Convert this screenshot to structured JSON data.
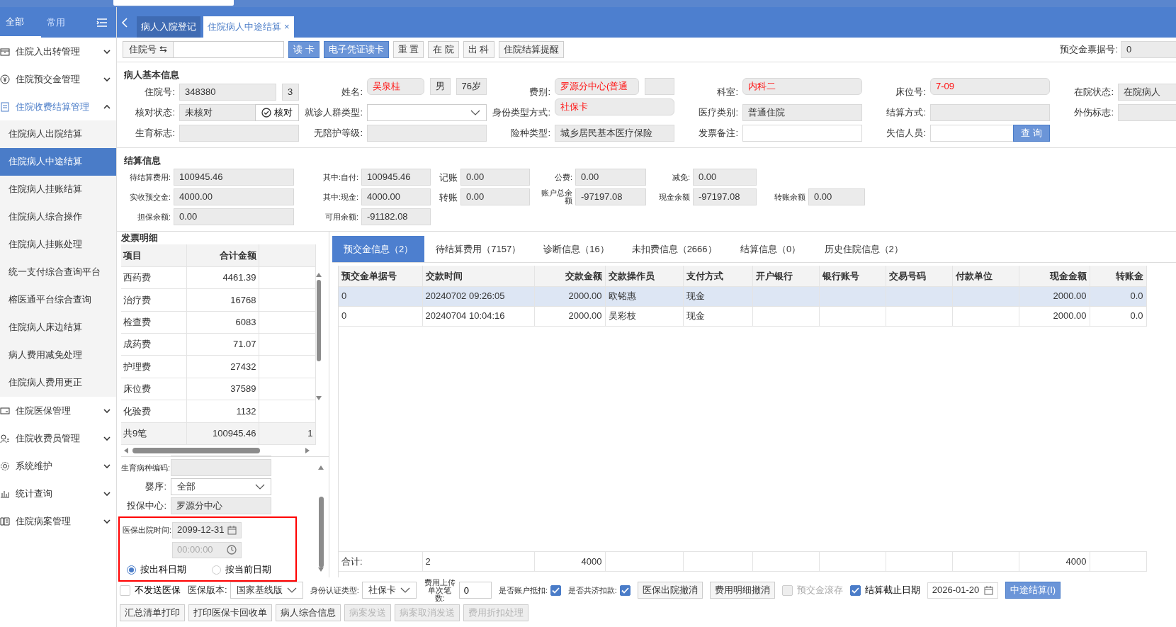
{
  "sidebar": {
    "tabs": [
      {
        "label": "全部",
        "selected": true
      },
      {
        "label": "常用",
        "selected": false
      }
    ],
    "items": [
      {
        "label": "住院入出转管理",
        "expanded": false
      },
      {
        "label": "住院预交金管理",
        "expanded": false
      },
      {
        "label": "住院收费结算管理",
        "expanded": true,
        "children": [
          {
            "label": "住院病人出院结算",
            "selected": false
          },
          {
            "label": "住院病人中途结算",
            "selected": true
          },
          {
            "label": "住院病人挂账结算",
            "selected": false
          },
          {
            "label": "住院病人综合操作",
            "selected": false
          },
          {
            "label": "住院病人挂账处理",
            "selected": false
          },
          {
            "label": "统一支付综合查询平台",
            "selected": false
          },
          {
            "label": "榕医通平台综合查询",
            "selected": false
          },
          {
            "label": "住院病人床边结算",
            "selected": false
          },
          {
            "label": "病人费用减免处理",
            "selected": false
          },
          {
            "label": "住院病人费用更正",
            "selected": false
          }
        ]
      },
      {
        "label": "住院医保管理",
        "expanded": false
      },
      {
        "label": "住院收费员管理",
        "expanded": false
      },
      {
        "label": "系统维护",
        "expanded": false
      },
      {
        "label": "统计查询",
        "expanded": false
      },
      {
        "label": "住院病案管理",
        "expanded": false
      }
    ]
  },
  "page_tabs": [
    {
      "label": "病人入院登记",
      "selected": false
    },
    {
      "label": "住院病人中途结算",
      "selected": true,
      "close": "×"
    }
  ],
  "toolbar": {
    "id_label": "住院号 ⇆",
    "buttons": [
      {
        "label": "读 卡",
        "kind": "primary"
      },
      {
        "label": "电子凭证读卡",
        "kind": "primary"
      },
      {
        "label": "重 置",
        "kind": "default"
      },
      {
        "label": "在 院",
        "kind": "default"
      },
      {
        "label": "出 科",
        "kind": "default"
      },
      {
        "label": "住院结算提醒",
        "kind": "default"
      }
    ],
    "receipt": {
      "label": "预交金票据号:",
      "value": "0"
    }
  },
  "patient_info": {
    "title": "病人基本信息",
    "rows": [
      [
        {
          "label": "住院号:",
          "values": [
            {
              "kind": "text",
              "text": "348380",
              "alert": false
            },
            {
              "kind": "text",
              "text": "3",
              "alert": false
            }
          ]
        },
        {
          "label": "姓名:",
          "values": [
            {
              "kind": "text",
              "text": "吴泉桂",
              "alert": true
            },
            {
              "kind": "text",
              "text": "男",
              "alert": false
            },
            {
              "kind": "text",
              "text": "76岁",
              "alert": false
            }
          ]
        },
        {
          "label": "费别:",
          "values": [
            {
              "kind": "text",
              "text": "罗源分中心(普通",
              "alert": true
            },
            {
              "kind": "text",
              "alert": false
            }
          ]
        },
        {
          "label": "科室:",
          "values": [
            {
              "kind": "text",
              "text": "内科二",
              "alert": true
            }
          ]
        },
        {
          "label": "床位号:",
          "values": [
            {
              "kind": "text",
              "text": "7-09",
              "alert": true
            }
          ]
        },
        {
          "label": "在院状态:",
          "values": [
            {
              "kind": "text",
              "text": "在院病人",
              "alert": false
            }
          ]
        }
      ],
      [
        {
          "label": "核对状态:",
          "values": [
            {
              "kind": "text",
              "text": "未核对",
              "alert": false
            },
            {
              "kind": "check_button",
              "text": "核对"
            }
          ]
        },
        {
          "label": "就诊人群类型:",
          "values": [
            {
              "kind": "select"
            }
          ]
        },
        {
          "label": "身份类型方式:",
          "values": [
            {
              "kind": "text",
              "text": "社保卡",
              "alert": true
            }
          ]
        },
        {
          "label": "医疗类别:",
          "values": [
            {
              "kind": "text",
              "text": "普通住院",
              "alert": false
            }
          ]
        },
        {
          "label": "结算方式:",
          "values": [
            {
              "kind": "text",
              "alert": false
            }
          ]
        },
        {
          "label": "外伤标志:",
          "values": [
            {
              "kind": "text",
              "alert": false
            }
          ]
        }
      ],
      [
        {
          "label": "生育标志:",
          "values": [
            {
              "kind": "text",
              "alert": false
            }
          ]
        },
        {
          "label": "无陪护等级:",
          "values": [
            {
              "kind": "text",
              "alert": false
            }
          ]
        },
        {
          "label": "险种类型:",
          "values": [
            {
              "kind": "text",
              "text": "城乡居民基本医疗保险",
              "alert": false
            }
          ]
        },
        {
          "label": "发票备注:",
          "values": [
            {
              "kind": "input"
            }
          ]
        },
        {
          "label": "失信人员:",
          "values": [
            {
              "kind": "input"
            },
            {
              "kind": "button",
              "text": "查 询"
            }
          ]
        }
      ]
    ]
  },
  "settlement": {
    "title": "结算信息",
    "rows": [
      [
        {
          "label": "待结算费用:",
          "value": "100945.46"
        },
        {
          "label": "其中:自付:",
          "value": "100945.46"
        },
        {
          "label": "记账",
          "value": "0.00"
        },
        {
          "label": "公费:",
          "value": "0.00"
        },
        {
          "label": "减免:",
          "value": "0.00"
        }
      ],
      [
        {
          "label": "实收预交金:",
          "value": "4000.00"
        },
        {
          "label": "其中:现金:",
          "value": "4000.00"
        },
        {
          "label": "转账",
          "value": "0.00"
        },
        {
          "label": "账户总余额",
          "value": "-97197.08"
        },
        {
          "label": "现金余额",
          "value": "-97197.08"
        },
        {
          "label": "转账余额",
          "value": "0.00"
        }
      ],
      [
        {
          "label": "担保余额:",
          "value": "0.00"
        },
        {
          "label": "可用余额:",
          "value": "-91182.08"
        }
      ]
    ]
  },
  "invoice": {
    "title": "发票明细",
    "columns": [
      "项目",
      "合计金额"
    ],
    "rows": [
      [
        "西药费",
        "4461.39"
      ],
      [
        "治疗费",
        "16768"
      ],
      [
        "检查费",
        "6083"
      ],
      [
        "成药费",
        "71.07"
      ],
      [
        "护理费",
        "27432"
      ],
      [
        "床位费",
        "37589"
      ],
      [
        "化验费",
        "1132"
      ]
    ],
    "footer": [
      "共9笔",
      "100945.46",
      "1"
    ]
  },
  "lower_form": {
    "fields": [
      {
        "label": "生育病种编码:",
        "kind": "text"
      },
      {
        "label": "婴序:",
        "kind": "select",
        "value": "全部"
      },
      {
        "label": "投保中心:",
        "kind": "text",
        "value": "罗源分中心"
      }
    ],
    "discharge": {
      "label": "医保出院时间:",
      "date": "2099-12-31",
      "time": "00:00:00",
      "options": [
        {
          "label": "按出科日期",
          "selected": true
        },
        {
          "label": "按当前日期",
          "selected": false
        }
      ]
    }
  },
  "detail_tabs": [
    {
      "label": "预交金信息（2）",
      "selected": true
    },
    {
      "label": "待结算费用（7157）",
      "selected": false
    },
    {
      "label": "诊断信息（16）",
      "selected": false
    },
    {
      "label": "未扣费信息（2666）",
      "selected": false
    },
    {
      "label": "结算信息（0）",
      "selected": false
    },
    {
      "label": "历史住院信息（2）",
      "selected": false
    }
  ],
  "prepaid_table": {
    "columns": [
      "预交金单据号",
      "交款时间",
      "交款金额",
      "交款操作员",
      "支付方式",
      "开户银行",
      "银行账号",
      "交易号码",
      "付款单位",
      "现金金额",
      "转账金"
    ],
    "rows": [
      {
        "selected": true,
        "cells": [
          "0",
          "20240702 09:26:05",
          "2000.00",
          "欧铭惠",
          "现金",
          null,
          null,
          null,
          null,
          "2000.00",
          "0.0"
        ]
      },
      {
        "selected": false,
        "cells": [
          "0",
          "20240704 10:04:16",
          "2000.00",
          "吴彩枝",
          "现金",
          null,
          null,
          null,
          null,
          "2000.00",
          "0.0"
        ]
      }
    ],
    "footer": {
      "label": "合计:",
      "count": "2",
      "amount": "4000",
      "cash": "4000"
    }
  },
  "bottom": {
    "row1": [
      {
        "kind": "checkbox",
        "label": "不发送医保",
        "checked": false,
        "disabled": false
      },
      {
        "kind": "select",
        "label": "医保版本:",
        "value": "国家基线版"
      },
      {
        "kind": "select",
        "label": "身份认证类型:",
        "value": "社保卡"
      },
      {
        "kind": "input",
        "label": "费用上传单次笔数:",
        "value": "0"
      },
      {
        "kind": "label_checkbox",
        "label": "是否账户抵扣:",
        "checked": true
      },
      {
        "kind": "label_checkbox",
        "label": "是否共济扣款:",
        "checked": true
      },
      {
        "kind": "button",
        "label": "医保出院撤消"
      },
      {
        "kind": "button",
        "label": "费用明细撤消"
      },
      {
        "kind": "checkbox",
        "label": "预交金滚存",
        "checked": false,
        "disabled": true
      },
      {
        "kind": "checkbox",
        "label": "结算截止日期",
        "checked": true,
        "disabled": false
      },
      {
        "kind": "date",
        "value": "2026-01-20"
      },
      {
        "kind": "primary",
        "label": "中途结算(I)"
      }
    ],
    "row2": [
      {
        "label": "汇总清单打印",
        "disabled": false
      },
      {
        "label": "打印医保卡回收单",
        "disabled": false
      },
      {
        "label": "病人综合信息",
        "disabled": false
      },
      {
        "label": "病案发送",
        "disabled": true
      },
      {
        "label": "病案取消发送",
        "disabled": true
      },
      {
        "label": "费用折扣处理",
        "disabled": true
      }
    ]
  }
}
